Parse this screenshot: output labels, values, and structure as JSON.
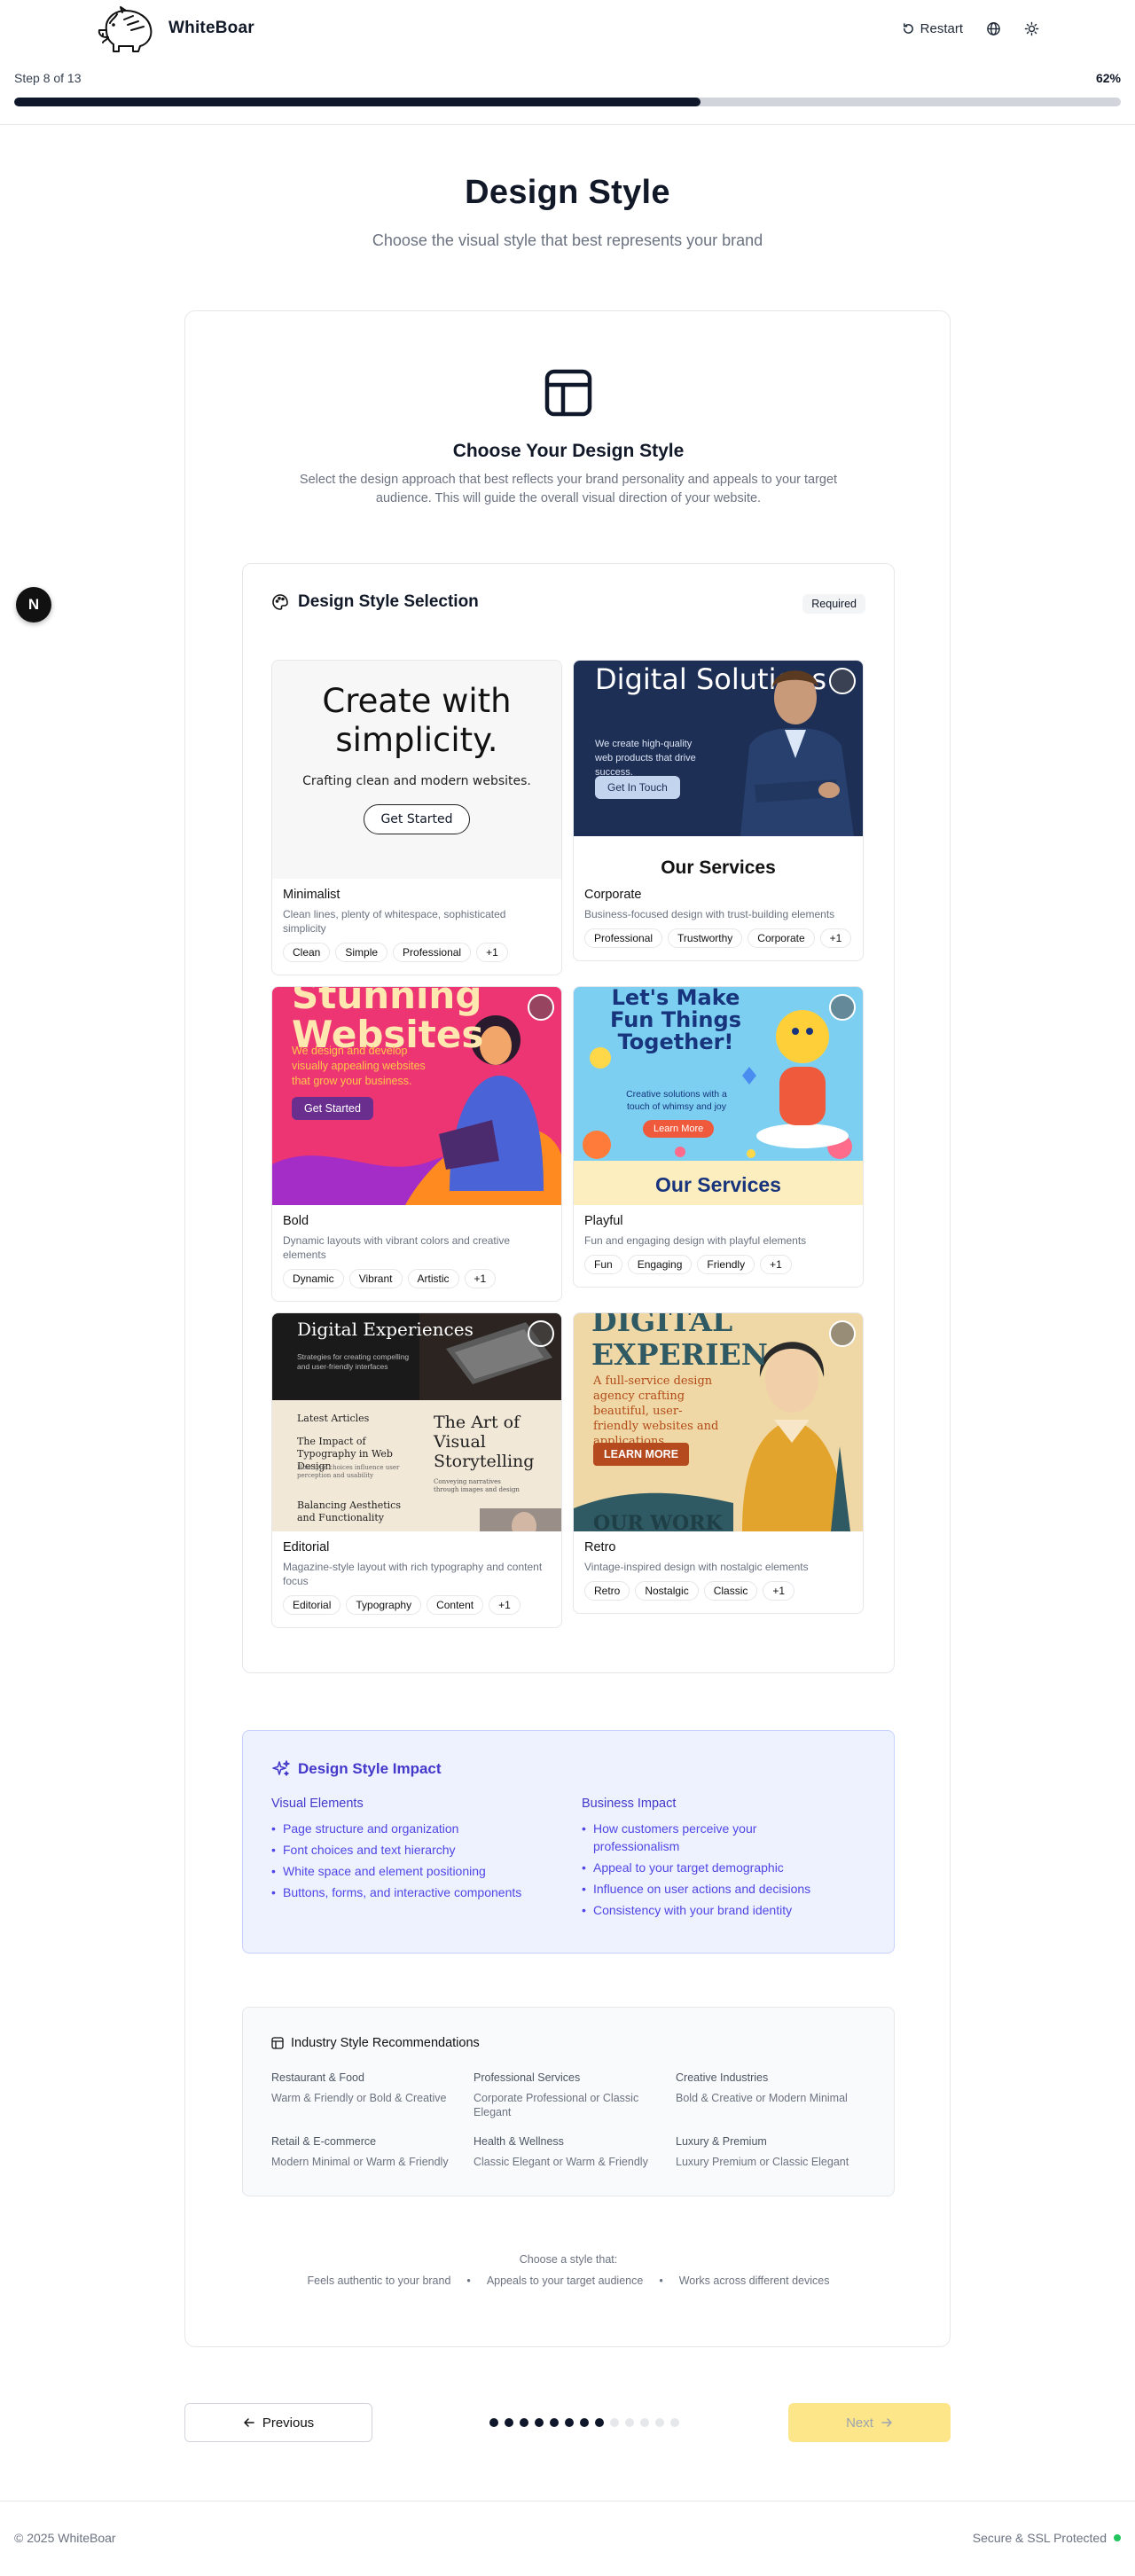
{
  "brand": {
    "name": "WhiteBoar"
  },
  "header": {
    "restart_label": "Restart",
    "globe_icon": "globe-icon",
    "theme_icon": "sun-icon"
  },
  "progress": {
    "step_label": "Step 8 of 13",
    "percent_label": "62%",
    "fraction": 0.62
  },
  "float_badge": {
    "letter": "N"
  },
  "page": {
    "title": "Design Style",
    "subtitle": "Choose the visual style that best represents your brand"
  },
  "intro": {
    "title": "Choose Your Design Style",
    "description": "Select the design approach that best reflects your brand personality and appeals to your target audience. This will guide the overall visual direction of your website."
  },
  "selection": {
    "title": "Design Style Selection",
    "badge": "Required",
    "styles": [
      {
        "name": "Minimalist",
        "description": "Clean lines, plenty of whitespace, sophisticated simplicity",
        "tags": [
          "Clean",
          "Simple",
          "Professional",
          "+1"
        ],
        "preview": {
          "heading": "Create with simplicity.",
          "sub": "Crafting clean and modern websites.",
          "button": "Get Started"
        }
      },
      {
        "name": "Corporate",
        "description": "Business-focused design with trust-building elements",
        "tags": [
          "Professional",
          "Trustworthy",
          "Corporate",
          "+1"
        ],
        "preview": {
          "heading": "Digital Solutions",
          "sub": "We create high-quality web products that drive success.",
          "button": "Get In Touch",
          "footer": "Our Services"
        }
      },
      {
        "name": "Bold",
        "description": "Dynamic layouts with vibrant colors and creative elements",
        "tags": [
          "Dynamic",
          "Vibrant",
          "Artistic",
          "+1"
        ],
        "preview": {
          "heading": "Stunning Websites",
          "sub": "We design and develop visually appealing websites that grow your business.",
          "button": "Get Started"
        }
      },
      {
        "name": "Playful",
        "description": "Fun and engaging design with playful elements",
        "tags": [
          "Fun",
          "Engaging",
          "Friendly",
          "+1"
        ],
        "preview": {
          "heading": "Let's Make Fun Things Together!",
          "sub": "Creative solutions with a touch of whimsy and joy",
          "button": "Learn More",
          "footer": "Our Services"
        }
      },
      {
        "name": "Editorial",
        "description": "Magazine-style layout with rich typography and content focus",
        "tags": [
          "Editorial",
          "Typography",
          "Content",
          "+1"
        ],
        "preview": {
          "heading": "Digital Experiences",
          "sub": "Strategies for creating compelling and user-friendly interfaces",
          "latest": "Latest Articles",
          "article1": "The Impact of Typography in Web Design",
          "article1_sub": "How type choices influence user perception and usability",
          "article2": "Balancing Aesthetics and Functionality",
          "feature": "The Art of Visual Storytelling",
          "feature_sub": "Conveying narratives through images and design"
        }
      },
      {
        "name": "Retro",
        "description": "Vintage-inspired design with nostalgic elements",
        "tags": [
          "Retro",
          "Nostalgic",
          "Classic",
          "+1"
        ],
        "preview": {
          "heading": "DIGITAL EXPERIEN",
          "sub": "A full-service design agency crafting beautiful, user-friendly websites and applications.",
          "button": "LEARN MORE",
          "footer": "OUR WORK"
        }
      }
    ]
  },
  "impact": {
    "title": "Design Style Impact",
    "visual": {
      "title": "Visual Elements",
      "items": [
        "Page structure and organization",
        "Font choices and text hierarchy",
        "White space and element positioning",
        "Buttons, forms, and interactive components"
      ]
    },
    "business": {
      "title": "Business Impact",
      "items": [
        "How customers perceive your professionalism",
        "Appeal to your target demographic",
        "Influence on user actions and decisions",
        "Consistency with your brand identity"
      ]
    }
  },
  "recommendations": {
    "title": "Industry Style Recommendations",
    "items": [
      {
        "industry": "Restaurant & Food",
        "styles": "Warm & Friendly or Bold & Creative"
      },
      {
        "industry": "Professional Services",
        "styles": "Corporate Professional or Classic Elegant"
      },
      {
        "industry": "Creative Industries",
        "styles": "Bold & Creative or Modern Minimal"
      },
      {
        "industry": "Retail & E-commerce",
        "styles": "Modern Minimal or Warm & Friendly"
      },
      {
        "industry": "Health & Wellness",
        "styles": "Classic Elegant or Warm & Friendly"
      },
      {
        "industry": "Luxury & Premium",
        "styles": "Luxury Premium or Classic Elegant"
      }
    ]
  },
  "hint": {
    "title": "Choose a style that:",
    "items": [
      "Feels authentic to your brand",
      "Appeals to your target audience",
      "Works across different devices"
    ]
  },
  "nav": {
    "previous_label": "Previous",
    "next_label": "Next",
    "total_steps": 13,
    "current_step": 8
  },
  "footer": {
    "copyright": "© 2025 WhiteBoar",
    "security": "Secure & SSL Protected"
  },
  "colors": {
    "accent": "#4338ca",
    "next_button": "#fde68a",
    "progress_fill": "#0f172a",
    "secure_dot": "#22c55e"
  }
}
